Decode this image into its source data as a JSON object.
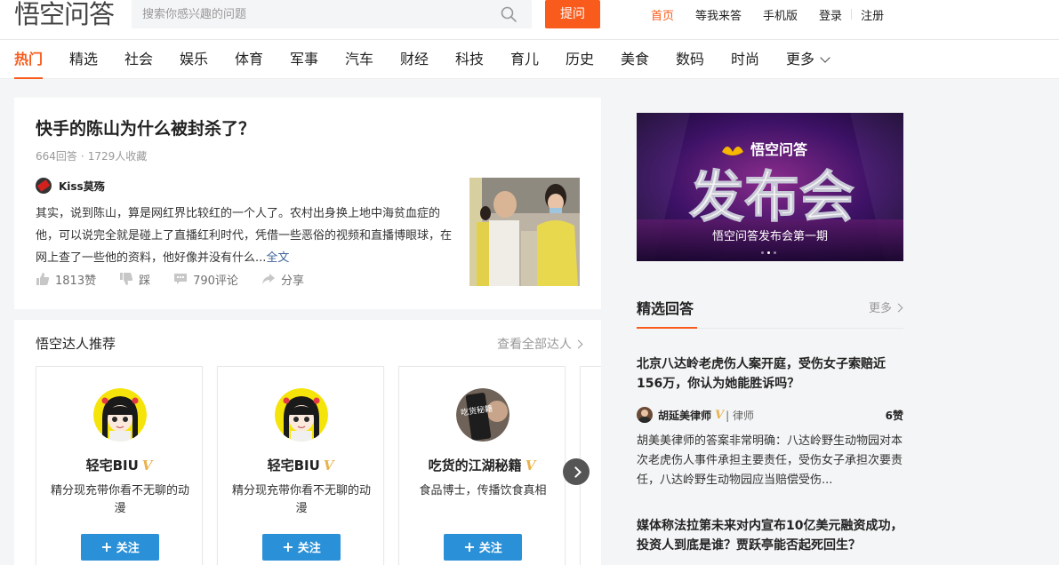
{
  "header": {
    "logo": "悟空问答",
    "search_placeholder": "搜索你感兴趣的问题",
    "ask_label": "提问",
    "nav": [
      {
        "label": "首页",
        "active": true
      },
      {
        "label": "等我来答",
        "active": false
      },
      {
        "label": "手机版",
        "active": false
      },
      {
        "label": "登录",
        "active": false
      },
      {
        "label": "注册",
        "active": false
      }
    ]
  },
  "categories": [
    "热门",
    "精选",
    "社会",
    "娱乐",
    "体育",
    "军事",
    "汽车",
    "财经",
    "科技",
    "育儿",
    "历史",
    "美食",
    "数码",
    "时尚",
    "更多"
  ],
  "question": {
    "title": "快手的陈山为什么被封杀了？",
    "answers": "664回答",
    "dot": "·",
    "favorites": "1729人收藏",
    "author": "Kiss莫殇",
    "excerpt": "其实，说到陈山，算是网红界比较红的一个人了。农村出身换上地中海贫血症的他，可以说完全就是碰上了直播红利时代，凭借一些恶俗的视频和直播博眼球，在网上查了一些他的资料，他好像并没有什么...",
    "more_link": "全文",
    "likes": "1813赞",
    "dislike": "踩",
    "comments": "790评论",
    "share": "分享"
  },
  "experts": {
    "title": "悟空达人推荐",
    "view_all": "查看全部达人",
    "follow_label": "关注",
    "v_mark": "V",
    "items": [
      {
        "name": "轻宅BIU",
        "desc": "精分现充带你看不无聊的动漫"
      },
      {
        "name": "轻宅BIU",
        "desc": "精分现充带你看不无聊的动漫"
      },
      {
        "name": "吃货的江湖秘籍",
        "desc": "食品博士，传播饮食真相"
      }
    ],
    "avatar_sign_text": "吃货秘籍"
  },
  "banner": {
    "logo_text": "悟空问答",
    "big_text": "发布会",
    "caption": "悟空问答发布会第一期"
  },
  "featured": {
    "title": "精选回答",
    "more": "更多",
    "items": [
      {
        "title": "北京八达岭老虎伤人案开庭，受伤女子索赔近156万，你认为她能胜诉吗？",
        "author": "胡延美律师",
        "v": "V",
        "role": "| 律师",
        "likes": "6赞",
        "text": "胡美美律师的答案非常明确：八达岭野生动物园对本次老虎伤人事件承担主要责任，受伤女子承担次要责任，八达岭野生动物园应当赔偿受伤..."
      },
      {
        "title": "媒体称法拉第未来对内宣布10亿美元融资成功，投资人到底是谁？贾跃亭能否起死回生？"
      }
    ]
  },
  "colors": {
    "accent": "#f85b1c",
    "follow_blue": "#2a90d7",
    "link": "#406599",
    "v_gold": "#e8b34d"
  }
}
